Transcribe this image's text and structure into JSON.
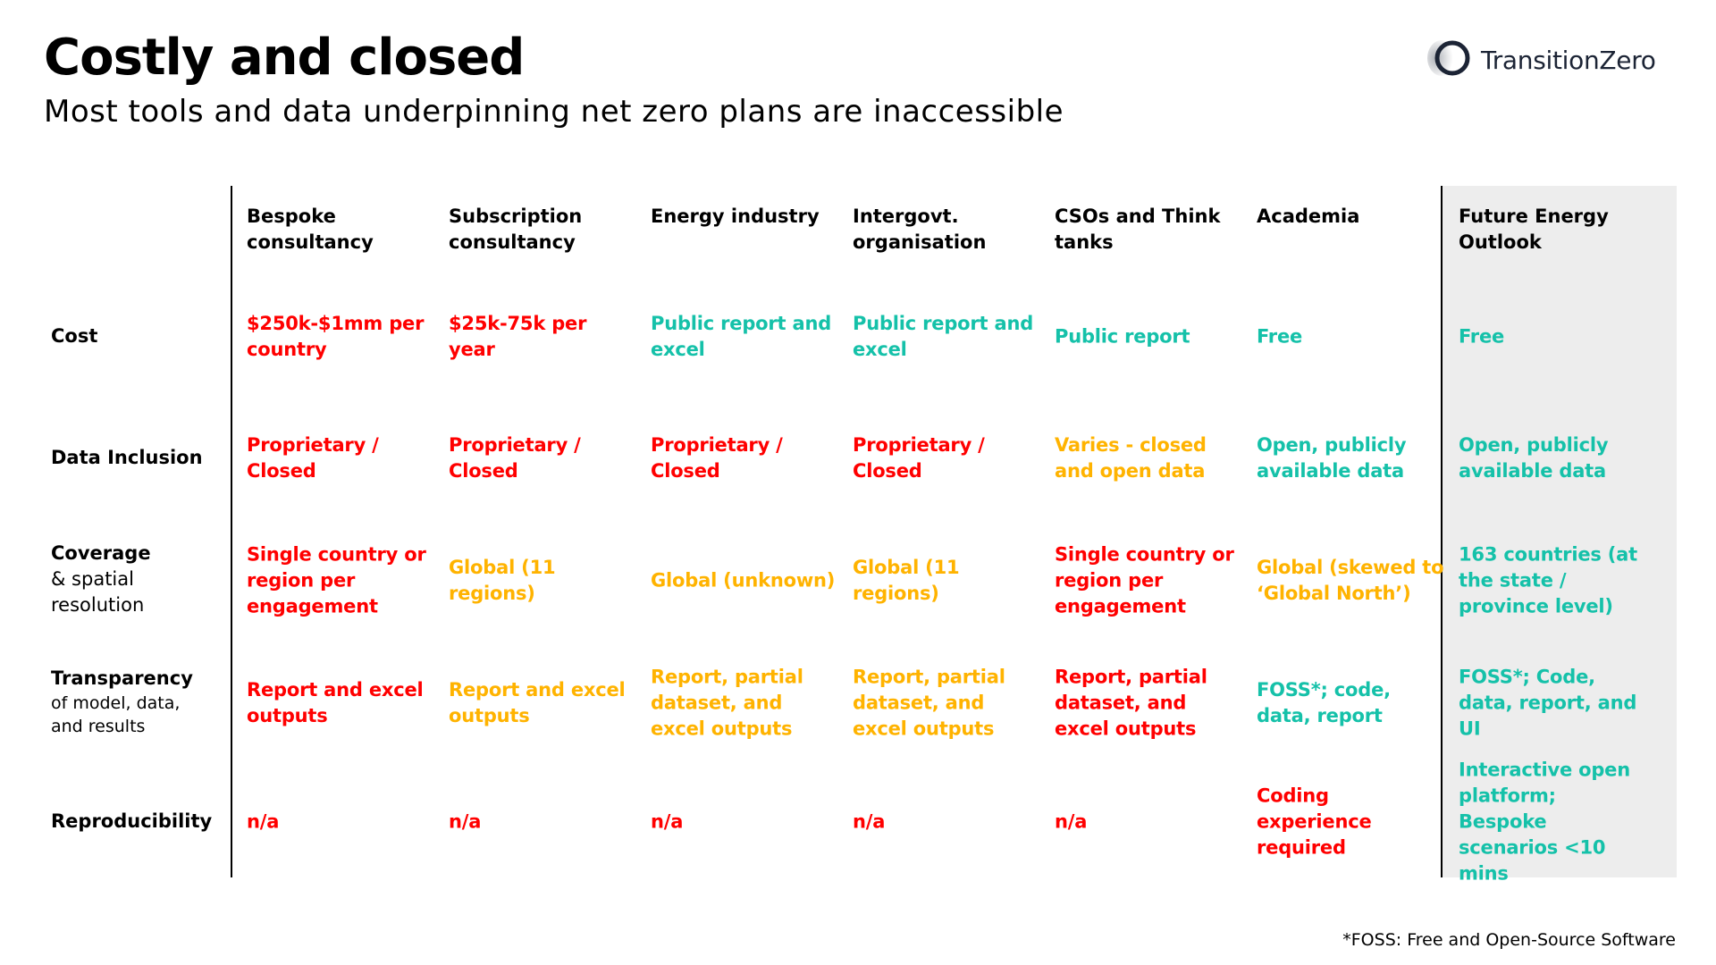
{
  "header": {
    "title": "Costly and closed",
    "subtitle": "Most tools and data underpinning net zero plans are inaccessible",
    "logo_text": "TransitionZero",
    "logo_icon": "ring-logo-icon"
  },
  "colors": {
    "red": "#ff0000",
    "amber": "#ffb300",
    "teal": "#15c1a9",
    "highlight_column_bg": "#ededed"
  },
  "table": {
    "columns": [
      "Bespoke consultancy",
      "Subscription consultancy",
      "Energy industry",
      "Intergovt. organisation",
      "CSOs and Think tanks",
      "Academia",
      "Future Energy Outlook"
    ],
    "highlighted_column": "Future Energy Outlook",
    "rows": [
      {
        "label": "Cost",
        "sublabel": "",
        "cells": [
          {
            "text": "$250k-$1mm per country",
            "rating": "red"
          },
          {
            "text": "$25k-75k per year",
            "rating": "red"
          },
          {
            "text": "Public report and excel",
            "rating": "teal"
          },
          {
            "text": "Public report and excel",
            "rating": "teal"
          },
          {
            "text": "Public report",
            "rating": "teal"
          },
          {
            "text": "Free",
            "rating": "teal"
          },
          {
            "text": "Free",
            "rating": "teal"
          }
        ]
      },
      {
        "label": "Data Inclusion",
        "sublabel": "",
        "cells": [
          {
            "text": "Proprietary / Closed",
            "rating": "red"
          },
          {
            "text": "Proprietary / Closed",
            "rating": "red"
          },
          {
            "text": "Proprietary / Closed",
            "rating": "red"
          },
          {
            "text": "Proprietary / Closed",
            "rating": "red"
          },
          {
            "text": "Varies - closed and open data",
            "rating": "amber"
          },
          {
            "text": "Open, publicly available data",
            "rating": "teal"
          },
          {
            "text": "Open, publicly available data",
            "rating": "teal"
          }
        ]
      },
      {
        "label": "Coverage",
        "sublabel": "& spatial resolution",
        "cells": [
          {
            "text": "Single country or region per engagement",
            "rating": "red"
          },
          {
            "text": "Global (11 regions)",
            "rating": "amber"
          },
          {
            "text": "Global (unknown)",
            "rating": "amber"
          },
          {
            "text": "Global (11 regions)",
            "rating": "amber"
          },
          {
            "text": "Single country or region per engagement",
            "rating": "red"
          },
          {
            "text": "Global (skewed to ‘Global North’)",
            "rating": "amber"
          },
          {
            "text": "163 countries (at the state / province level)",
            "rating": "teal"
          }
        ]
      },
      {
        "label": "Transparency",
        "sublabel": "of model, data, and results",
        "cells": [
          {
            "text": "Report and excel outputs",
            "rating": "red"
          },
          {
            "text": "Report and excel outputs",
            "rating": "amber"
          },
          {
            "text": "Report, partial dataset, and excel outputs",
            "rating": "amber"
          },
          {
            "text": "Report, partial dataset, and excel outputs",
            "rating": "amber"
          },
          {
            "text": "Report, partial dataset, and excel outputs",
            "rating": "red"
          },
          {
            "text": "FOSS*; code, data, report",
            "rating": "teal"
          },
          {
            "text": "FOSS*; Code, data, report, and UI",
            "rating": "teal"
          }
        ]
      },
      {
        "label": "Reproducibility",
        "sublabel": "",
        "cells": [
          {
            "text": "n/a",
            "rating": "red"
          },
          {
            "text": "n/a",
            "rating": "red"
          },
          {
            "text": "n/a",
            "rating": "red"
          },
          {
            "text": "n/a",
            "rating": "red"
          },
          {
            "text": "n/a",
            "rating": "red"
          },
          {
            "text": "Coding experience required",
            "rating": "red"
          },
          {
            "text": "Interactive open platform; Bespoke scenarios <10 mins",
            "rating": "teal"
          }
        ]
      }
    ]
  },
  "footnote": "*FOSS: Free and Open-Source Software"
}
